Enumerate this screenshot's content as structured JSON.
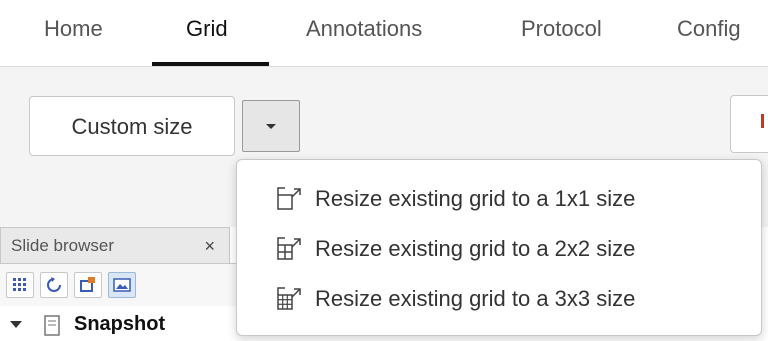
{
  "tabs": [
    {
      "label": "Home",
      "active": false
    },
    {
      "label": "Grid",
      "active": true
    },
    {
      "label": "Annotations",
      "active": false
    },
    {
      "label": "Protocol",
      "active": false
    },
    {
      "label": "Config",
      "active": false
    }
  ],
  "toolbar": {
    "custom_size_label": "Custom size",
    "dropdown_icon": "caret-down-icon"
  },
  "slide_browser": {
    "tab_label": "Slide browser",
    "close_label": "×",
    "tools": [
      {
        "icon": "grid-dots-icon"
      },
      {
        "icon": "refresh-icon"
      },
      {
        "icon": "open-window-icon"
      },
      {
        "icon": "image-icon",
        "active": true
      }
    ],
    "tree": {
      "label": "Snapshot",
      "icon": "document-icon",
      "expanded": true
    }
  },
  "menu": {
    "items": [
      {
        "label": "Resize existing grid to a 1x1 size",
        "icon": "resize-grid-1x1-icon"
      },
      {
        "label": "Resize existing grid to a 2x2 size",
        "icon": "resize-grid-2x2-icon"
      },
      {
        "label": "Resize existing grid to a 3x3 size",
        "icon": "resize-grid-3x3-icon"
      }
    ]
  },
  "colors": {
    "accent": "#111111",
    "toolbar_bg": "#f4f4f4",
    "menu_border": "#c8c8c8"
  }
}
